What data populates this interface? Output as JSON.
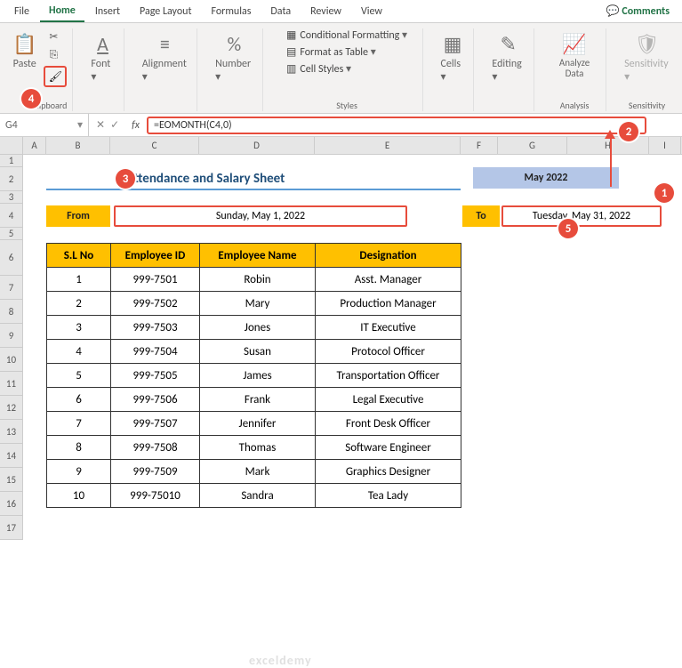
{
  "tabs": [
    "File",
    "Home",
    "Insert",
    "Page Layout",
    "Formulas",
    "Data",
    "Review",
    "View"
  ],
  "active_tab": "Home",
  "comments_label": "Comments",
  "ribbon": {
    "paste": "Paste",
    "clipboard": "Clipboard",
    "font": "Font",
    "alignment": "Alignment",
    "number": "Number",
    "cond_fmt": "Conditional Formatting",
    "fmt_table": "Format as Table",
    "cell_styles": "Cell Styles",
    "styles": "Styles",
    "cells": "Cells",
    "editing": "Editing",
    "analyze": "Analyze Data",
    "analysis": "Analysis",
    "sensitivity": "Sensitivity"
  },
  "name_box": "G4",
  "formula": "=EOMONTH(C4,0)",
  "sheet": {
    "title": "Attendance and Salary Sheet",
    "month": "May 2022",
    "from_label": "From",
    "from_value": "Sunday, May 1, 2022",
    "to_label": "To",
    "to_value": "Tuesday, May 31, 2022"
  },
  "columns": [
    "A",
    "B",
    "C",
    "D",
    "E",
    "F",
    "G",
    "H",
    "I"
  ],
  "rows_labels": [
    "1",
    "2",
    "3",
    "4",
    "5",
    "6",
    "7",
    "8",
    "9",
    "10",
    "11",
    "12",
    "13",
    "14",
    "15",
    "16",
    "17"
  ],
  "headers": {
    "sl": "S.L No",
    "eid": "Employee ID",
    "ename": "Employee Name",
    "des": "Designation"
  },
  "employees": [
    {
      "sl": "1",
      "id": "999-7501",
      "name": "Robin",
      "des": "Asst. Manager"
    },
    {
      "sl": "2",
      "id": "999-7502",
      "name": "Mary",
      "des": "Production Manager"
    },
    {
      "sl": "3",
      "id": "999-7503",
      "name": "Jones",
      "des": "IT Executive"
    },
    {
      "sl": "4",
      "id": "999-7504",
      "name": "Susan",
      "des": "Protocol Officer"
    },
    {
      "sl": "5",
      "id": "999-7505",
      "name": "James",
      "des": "Transportation Officer"
    },
    {
      "sl": "6",
      "id": "999-7506",
      "name": "Frank",
      "des": "Legal Executive"
    },
    {
      "sl": "7",
      "id": "999-7507",
      "name": "Jennifer",
      "des": "Front Desk Officer"
    },
    {
      "sl": "8",
      "id": "999-7508",
      "name": "Thomas",
      "des": "Software Engineer"
    },
    {
      "sl": "9",
      "id": "999-7509",
      "name": "Mark",
      "des": "Graphics Designer"
    },
    {
      "sl": "10",
      "id": "999-75010",
      "name": "Sandra",
      "des": "Tea Lady"
    }
  ],
  "callouts": {
    "c1": "1",
    "c2": "2",
    "c3": "3",
    "c4": "4",
    "c5": "5"
  },
  "watermark": "exceldemy"
}
